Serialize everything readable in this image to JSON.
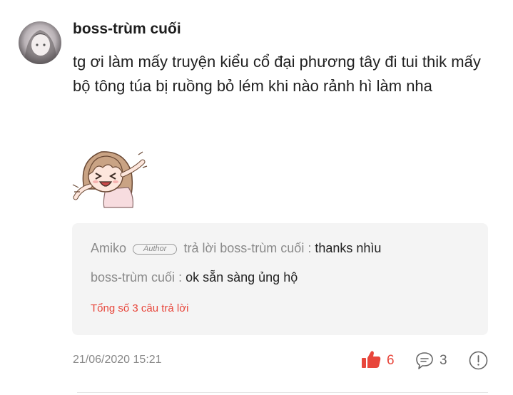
{
  "comment": {
    "username": "boss-trùm cuối",
    "text": "tg ơi làm mấy truyện kiểu cổ đại phương tây đi tui thik mấy bộ tông túa bị ruồng bỏ lém khi nào rảnh hì làm nha",
    "date": "21/06/2020 15:21",
    "likes": "6",
    "replies_count": "3"
  },
  "replies": [
    {
      "user": "Amiko",
      "badge": "Author",
      "connector": "trả lời boss-trùm cuối :",
      "message": "thanks nhìu"
    },
    {
      "user": "boss-trùm cuối",
      "connector": ":",
      "message": "ok sẵn sàng ủng hộ"
    }
  ],
  "total_replies_link": "Tổng số 3 câu trả lời",
  "icons": {
    "avatar": "user-avatar",
    "sticker": "anime-girl-sticker",
    "like": "thumbs-up-icon",
    "comment": "speech-bubble-icon",
    "report": "exclamation-circle-icon"
  },
  "colors": {
    "accent": "#e8463b",
    "muted": "#8a8a8a",
    "reply_bg": "#f4f4f4"
  }
}
